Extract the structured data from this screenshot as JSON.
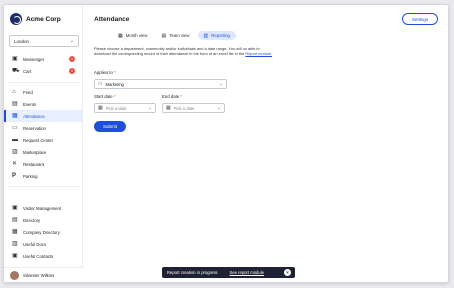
{
  "brand": {
    "name": "Acme Corp"
  },
  "location": {
    "value": "London"
  },
  "sidebar": {
    "group1": [
      {
        "label": "Messenger",
        "icon": "messenger-icon",
        "glyph": "▣",
        "badge": "1"
      },
      {
        "label": "Cart",
        "icon": "cart-icon",
        "glyph": "⛟",
        "badge": "1"
      }
    ],
    "group2": [
      {
        "label": "Feed",
        "icon": "home-icon",
        "glyph": "⌂"
      },
      {
        "label": "Events",
        "icon": "events-icon",
        "glyph": "▤"
      },
      {
        "label": "Attendance",
        "icon": "calendar-icon",
        "glyph": "▦",
        "active": true
      },
      {
        "label": "Reservation",
        "icon": "reservation-icon",
        "glyph": "▭"
      },
      {
        "label": "Request Center",
        "icon": "request-icon",
        "glyph": "▬"
      },
      {
        "label": "Marketplace",
        "icon": "marketplace-icon",
        "glyph": "▥"
      },
      {
        "label": "Restaurant",
        "icon": "restaurant-icon",
        "glyph": "✕"
      },
      {
        "label": "Parking",
        "icon": "parking-icon",
        "glyph": "P"
      }
    ],
    "group3": [
      {
        "label": "Visitor Management",
        "icon": "visitor-icon",
        "glyph": "▣"
      },
      {
        "label": "Directory",
        "icon": "directory-icon",
        "glyph": "▤"
      },
      {
        "label": "Company Directory",
        "icon": "company-directory-icon",
        "glyph": "▦"
      },
      {
        "label": "Useful Docs",
        "icon": "docs-icon",
        "glyph": "▥"
      },
      {
        "label": "Useful Contacts",
        "icon": "contacts-icon",
        "glyph": "▣"
      }
    ]
  },
  "user": {
    "name": "Silvester Wilkins"
  },
  "page": {
    "title": "Attendance",
    "settings_label": "Settings"
  },
  "tabs": [
    {
      "label": "Month view",
      "icon": "calendar-icon",
      "glyph": "▦"
    },
    {
      "label": "Team view",
      "icon": "team-icon",
      "glyph": "▤"
    },
    {
      "label": "Reporting",
      "icon": "report-icon",
      "glyph": "▥",
      "active": true
    }
  ],
  "form": {
    "description_pre": "Please choose a department, community and/or individuals and a date range. You will no able to download the corresponding record of their attendance in the form of an excel file in the",
    "description_link": "Report module.",
    "applies_to": {
      "label": "Applies to",
      "required": "*",
      "value": "Marketing",
      "icon": "users-icon"
    },
    "start_date": {
      "label": "Start date",
      "required": "*",
      "placeholder": "Pick a date"
    },
    "end_date": {
      "label": "End date",
      "required": "*",
      "placeholder": "Pick a date"
    },
    "submit_label": "Submit"
  },
  "toast": {
    "message": "Report creation in progress",
    "link": "See report module"
  }
}
